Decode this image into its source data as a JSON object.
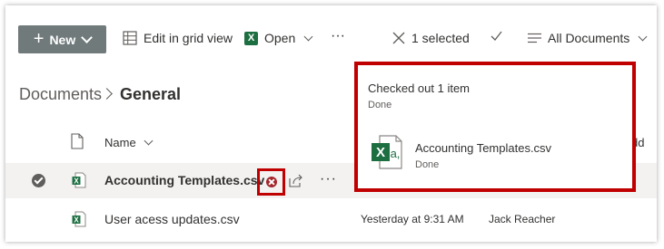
{
  "toolbar": {
    "new_label": "New",
    "edit_grid_label": "Edit in grid view",
    "open_label": "Open",
    "more_label": "···",
    "selected_label": "1 selected",
    "view_label": "All Documents"
  },
  "breadcrumb": {
    "root": "Documents",
    "current": "General"
  },
  "list": {
    "header_name": "Name",
    "header_edge": "dd",
    "rows": [
      {
        "name": "Accounting Templates.csv",
        "modified": "",
        "modified_by": "",
        "selected": true,
        "checked_out": true
      },
      {
        "name": "User acess updates.csv",
        "modified": "Yesterday at 9:31 AM",
        "modified_by": "Jack Reacher",
        "selected": false,
        "checked_out": false
      }
    ],
    "row_more_label": "···"
  },
  "popup": {
    "title": "Checked out 1 item",
    "status": "Done",
    "file_name": "Accounting Templates.csv",
    "file_status": "Done"
  },
  "icons": {
    "new": "plus-icon",
    "grid": "grid-icon",
    "excel": "excel-icon",
    "close": "close-icon",
    "check": "checkmark-icon",
    "view": "list-view-icon",
    "file": "document-icon",
    "checkout": "checked-out-icon",
    "share": "share-icon"
  },
  "colors": {
    "new_button_bg": "#707a7b",
    "highlight_border": "#c00000",
    "excel_green": "#1d6f42",
    "selected_row_bg": "#f3f2f1"
  }
}
